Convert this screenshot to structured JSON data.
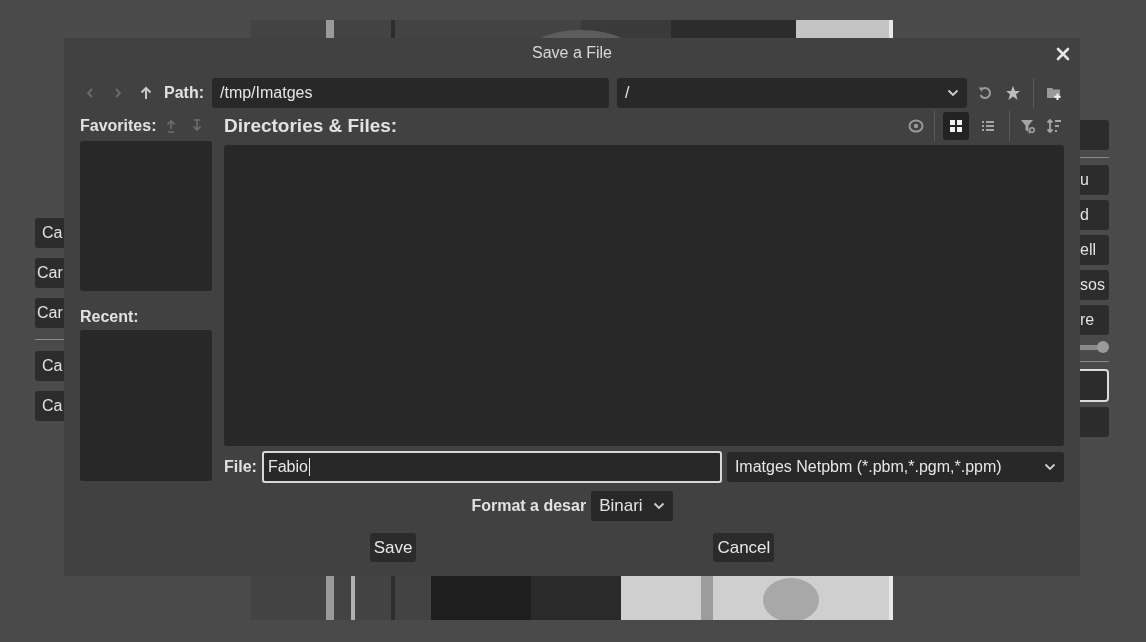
{
  "background": {
    "left_items": [
      {
        "kind": "button",
        "label": "Ca"
      },
      {
        "kind": "button",
        "label": "Car"
      },
      {
        "kind": "button",
        "label": "Car"
      },
      {
        "kind": "divider"
      },
      {
        "kind": "button",
        "label": "Ca"
      },
      {
        "kind": "button",
        "label": "Ca"
      }
    ],
    "right_items": [
      {
        "kind": "button",
        "focused": false
      },
      {
        "kind": "divider"
      },
      {
        "kind": "button",
        "label": "u",
        "focused": false
      },
      {
        "kind": "button",
        "label": "d",
        "focused": false
      },
      {
        "kind": "button",
        "label": "ell",
        "focused": false
      },
      {
        "kind": "button",
        "label": "sos",
        "focused": false
      },
      {
        "kind": "button",
        "label": "re",
        "focused": false
      },
      {
        "kind": "slider",
        "level": 0.8
      },
      {
        "kind": "divider"
      },
      {
        "kind": "button",
        "focused": true
      },
      {
        "kind": "button",
        "focused": false
      }
    ]
  },
  "dialog": {
    "title": "Save a File",
    "nav": [
      {
        "kind": "back",
        "disabled": true
      },
      {
        "kind": "forward",
        "disabled": true
      },
      {
        "kind": "up",
        "disabled": false
      }
    ],
    "path_label": "Path:",
    "path": "/tmp/Imatges",
    "drive": "/",
    "favorites_label": "Favorites:",
    "favorite_moves": [
      {
        "kind": "up",
        "disabled": true
      },
      {
        "kind": "down",
        "disabled": true
      }
    ],
    "recent_label": "Recent:",
    "files_label": "Directories & Files:",
    "view_modes": [
      {
        "kind": "grid",
        "selected": true
      },
      {
        "kind": "list",
        "selected": false
      }
    ],
    "file_label": "File:",
    "file_name": "Fabio",
    "file_focused": true,
    "filter": "Imatges Netpbm (*.pbm,*.pgm,*.ppm)",
    "format_label": "Format a desar",
    "format": "Binari",
    "buttons": [
      {
        "label": "Save"
      },
      {
        "label": "Cancel"
      }
    ]
  }
}
